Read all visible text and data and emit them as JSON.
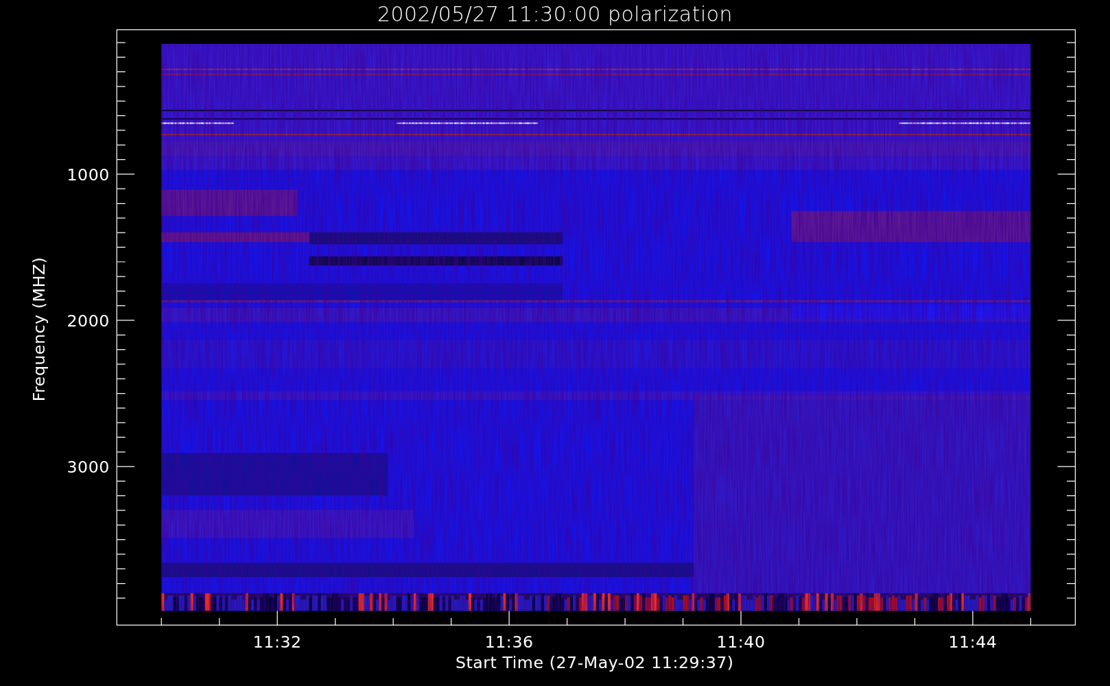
{
  "title": "2002/05/27 11:30:00 polarization",
  "x_axis": {
    "label": "Start Time (27-May-02 11:29:37)",
    "ticks": [
      "11:32",
      "11:36",
      "11:40",
      "11:44"
    ]
  },
  "y_axis": {
    "label": "Frequency (MHZ)",
    "ticks": [
      "1000",
      "2000",
      "3000"
    ]
  }
}
